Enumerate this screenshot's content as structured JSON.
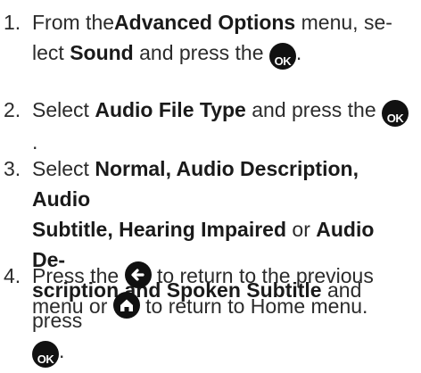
{
  "steps": [
    {
      "number": "1.",
      "parts": [
        "From the",
        "Advanced Options",
        " menu, se-",
        "lect ",
        "Sound",
        " and press the ",
        "OK",
        "."
      ]
    },
    {
      "number": "2.",
      "parts": [
        "Select ",
        "Audio File Type",
        " and press the ",
        "OK",
        "."
      ]
    },
    {
      "number": "3.",
      "parts": [
        "Select ",
        "Normal",
        ", ",
        "Audio Description",
        ", ",
        "Audio",
        "Subtitle",
        ", ",
        "Hearing Impaired",
        " or ",
        "Audio De-",
        "scription and Spoken Subtitle",
        " and press",
        "OK",
        "."
      ]
    },
    {
      "number": "4.",
      "parts": [
        "Press the ",
        "to return to the previous",
        "menu or ",
        "to return to Home menu."
      ]
    }
  ],
  "icons": {
    "ok_label": "OK",
    "ok_icon": "ok-button-icon",
    "back_icon": "back-arrow-icon",
    "home_icon": "home-icon"
  },
  "colors": {
    "text": "#2b2b2b",
    "icon_bg": "#111111",
    "icon_fg": "#ffffff"
  }
}
